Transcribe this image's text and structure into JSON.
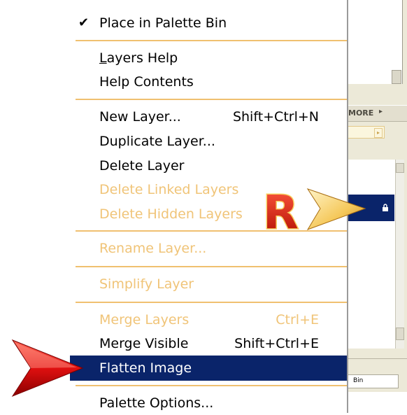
{
  "menu": {
    "items": [
      {
        "label": "Place in Palette Bin",
        "checked": true,
        "enabled": true
      },
      {
        "label": "Layers Help",
        "underline_char": "L",
        "enabled": true
      },
      {
        "label": "Help Contents",
        "enabled": true
      },
      {
        "label": "New Layer...",
        "shortcut": "Shift+Ctrl+N",
        "enabled": true
      },
      {
        "label": "Duplicate Layer...",
        "enabled": true
      },
      {
        "label": "Delete Layer",
        "enabled": true
      },
      {
        "label": "Delete Linked Layers",
        "enabled": false
      },
      {
        "label": "Delete Hidden Layers",
        "enabled": false
      },
      {
        "label": "Rename Layer...",
        "enabled": false
      },
      {
        "label": "Simplify Layer",
        "enabled": false
      },
      {
        "label": "Merge Layers",
        "shortcut": "Ctrl+E",
        "enabled": false
      },
      {
        "label": "Merge Visible",
        "shortcut": "Shift+Ctrl+E",
        "enabled": true
      },
      {
        "label": "Flatten Image",
        "enabled": true,
        "highlighted": true
      },
      {
        "label": "Palette Options...",
        "enabled": true
      }
    ]
  },
  "panel": {
    "more_label": "MORE",
    "bin_label": "Bin"
  },
  "badge_letter": "R",
  "colors": {
    "highlight": "#0a246a",
    "disabled_text": "#f0c478",
    "separator": "#f0c070",
    "pointer_arrow": "#e01010",
    "badge_fill": "#e52a1a"
  }
}
